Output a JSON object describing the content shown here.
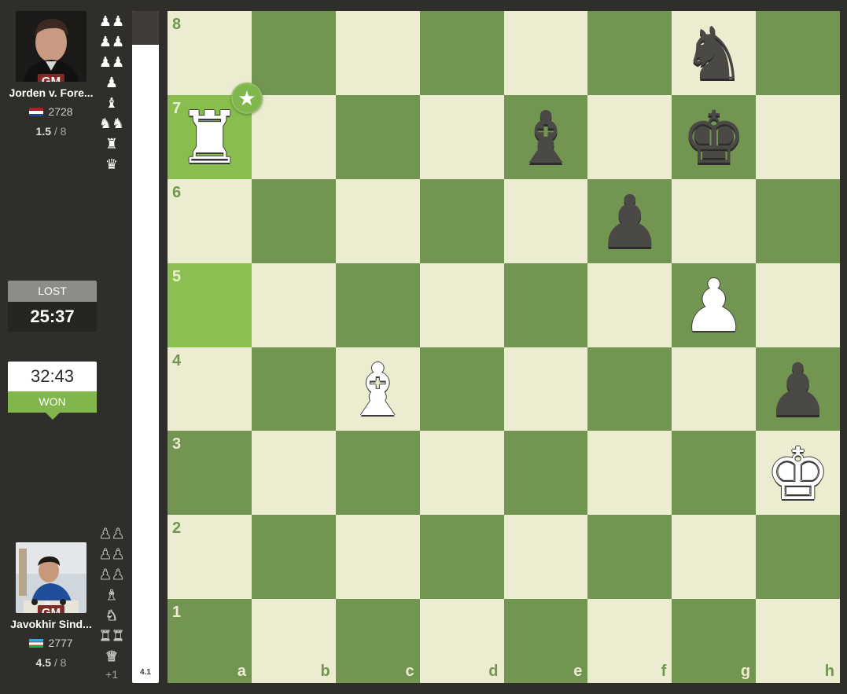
{
  "top_player": {
    "name": "Jorden v. Fore...",
    "title": "GM",
    "rating": "2728",
    "score": "1.5",
    "score_total": "/ 8",
    "flag": "netherlands-flag",
    "captured": [
      "♟♟",
      "♟♟",
      "♟♟",
      "♟",
      "♝",
      "♞♞",
      "♜",
      "♛"
    ]
  },
  "bottom_player": {
    "name": "Javokhir Sind...",
    "title": "GM",
    "rating": "2777",
    "score": "4.5",
    "score_total": "/ 8",
    "flag": "uzbekistan-flag",
    "captured": [
      "♟♟",
      "♟♟",
      "♟♟",
      "♝",
      "♞",
      "♜♜",
      "♛"
    ],
    "material_diff": "+1"
  },
  "clocks": {
    "top": {
      "status": "LOST",
      "time": "25:37"
    },
    "bottom": {
      "status": "WON",
      "time": "32:43"
    }
  },
  "eval": {
    "label": "4.1",
    "white_share": 0.95
  },
  "board": {
    "files": [
      "a",
      "b",
      "c",
      "d",
      "e",
      "f",
      "g",
      "h"
    ],
    "ranks": [
      "8",
      "7",
      "6",
      "5",
      "4",
      "3",
      "2",
      "1"
    ],
    "highlighted": [
      "a5",
      "a7"
    ],
    "best_move_badge": {
      "square": "a7",
      "icon": "star-icon"
    },
    "pieces": [
      {
        "square": "g8",
        "color": "b",
        "type": "knight",
        "glyph": "♞"
      },
      {
        "square": "a7",
        "color": "w",
        "type": "rook",
        "glyph": "♜"
      },
      {
        "square": "e7",
        "color": "b",
        "type": "bishop",
        "glyph": "♝"
      },
      {
        "square": "g7",
        "color": "b",
        "type": "king",
        "glyph": "♚"
      },
      {
        "square": "f6",
        "color": "b",
        "type": "pawn",
        "glyph": "♟"
      },
      {
        "square": "g5",
        "color": "w",
        "type": "pawn",
        "glyph": "♟"
      },
      {
        "square": "c4",
        "color": "w",
        "type": "bishop",
        "glyph": "♝"
      },
      {
        "square": "h4",
        "color": "b",
        "type": "pawn",
        "glyph": "♟"
      },
      {
        "square": "h3",
        "color": "w",
        "type": "king",
        "glyph": "♚"
      }
    ]
  },
  "colors": {
    "light_square": "#ebecd0",
    "dark_square": "#739552",
    "highlight": "#8bbf4f",
    "won_green": "#81b64c",
    "title_badge": "#7f2a25"
  }
}
